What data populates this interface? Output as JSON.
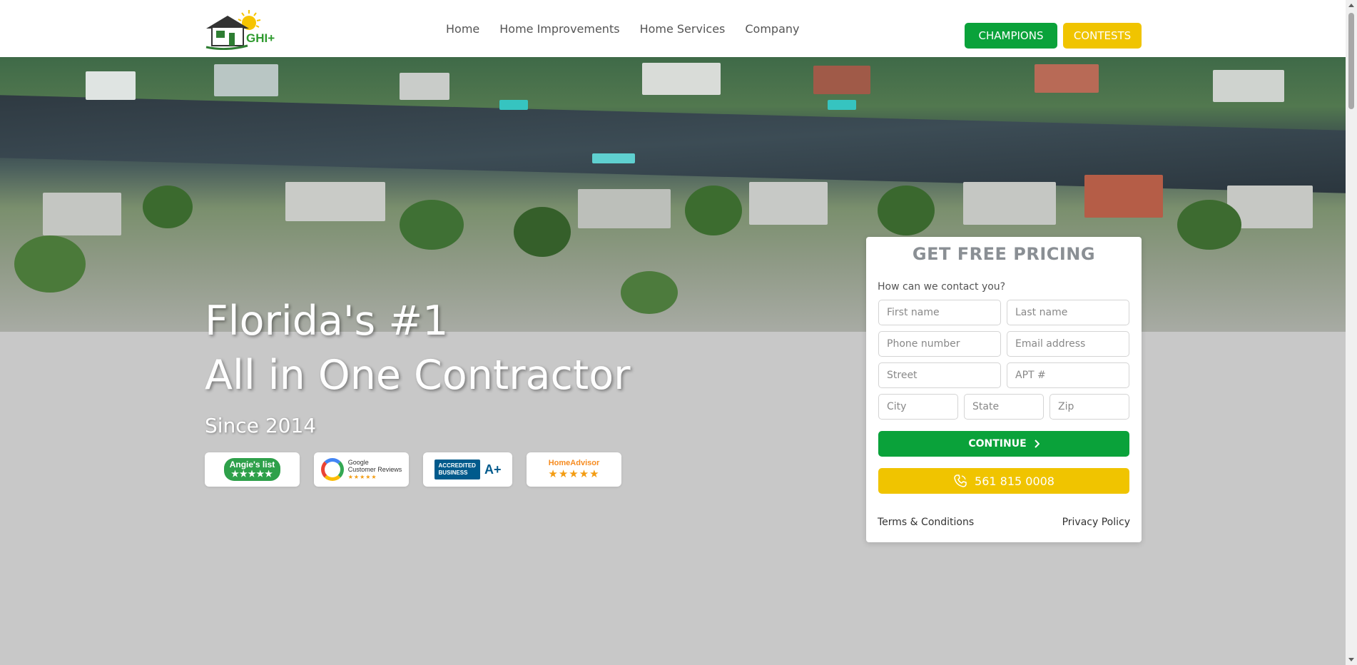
{
  "header": {
    "logo_text": "GHI+",
    "nav": [
      "Home",
      "Home Improvements",
      "Home Services",
      "Company"
    ],
    "champions_label": "CHAMPIONS",
    "contests_label": "CONTESTS"
  },
  "hero": {
    "title_line1": "Florida's #1",
    "title_line2": "All in One Contractor",
    "since": "Since 2014",
    "badges": {
      "angies": "Angie's list",
      "google_line1": "Google",
      "google_line2": "Customer Reviews",
      "bbb_line1": "ACCREDITED",
      "bbb_line2": "BUSINESS",
      "bbb_grade": "A+",
      "homeadvisor": "HomeAdvisor"
    }
  },
  "form": {
    "title": "GET FREE PRICING",
    "question": "How can we contact you?",
    "placeholders": {
      "first_name": "First name",
      "last_name": "Last name",
      "phone": "Phone number",
      "email": "Email address",
      "street": "Street",
      "apt": "APT #",
      "city": "City",
      "state": "State",
      "zip": "Zip"
    },
    "continue_label": "CONTINUE",
    "phone_label": "561 815 0008",
    "terms_label": "Terms & Conditions",
    "privacy_label": "Privacy Policy"
  },
  "colors": {
    "green": "#0aa23a",
    "yellow": "#f0c400",
    "page_bg": "#c8c8c8"
  },
  "icons": [
    "house-logo-icon",
    "sun-icon",
    "phone-icon",
    "chevron-right-icon",
    "star-icon"
  ]
}
